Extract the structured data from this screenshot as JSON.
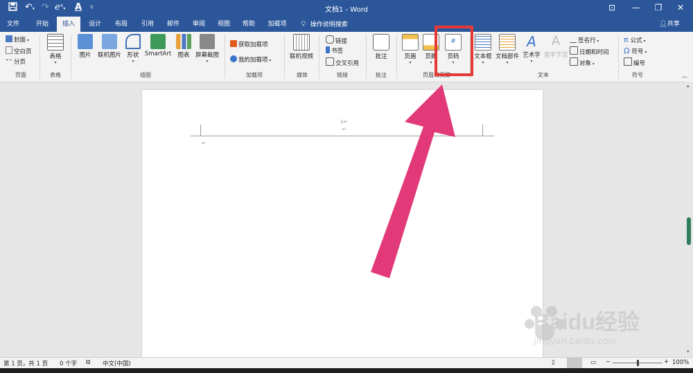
{
  "app": {
    "doc_title": "文档1 - Word"
  },
  "titlebar": {
    "share_label": "共享"
  },
  "tabs": [
    {
      "label": "文件"
    },
    {
      "label": "开始"
    },
    {
      "label": "插入"
    },
    {
      "label": "设计"
    },
    {
      "label": "布局"
    },
    {
      "label": "引用"
    },
    {
      "label": "邮件"
    },
    {
      "label": "审阅"
    },
    {
      "label": "视图"
    },
    {
      "label": "帮助"
    },
    {
      "label": "加载项"
    }
  ],
  "tellme": {
    "label": "操作说明搜索"
  },
  "ribbon": {
    "pages": {
      "cover": "封面",
      "blank": "空白页",
      "break": "分页",
      "group": "页面"
    },
    "tables": {
      "table": "表格",
      "group": "表格"
    },
    "illustrations": {
      "pictures": "图片",
      "online_pictures": "联机图片",
      "shapes": "形状",
      "smartart": "SmartArt",
      "chart": "图表",
      "screenshot": "屏幕截图",
      "group": "插图"
    },
    "addins": {
      "get": "获取加载项",
      "my": "我的加载项",
      "group": "加载项"
    },
    "media": {
      "online_video": "联机视频",
      "group": "媒体"
    },
    "links": {
      "link": "链接",
      "bookmark": "书签",
      "crossref": "交叉引用",
      "group": "链接"
    },
    "comments": {
      "comment": "批注",
      "group": "批注"
    },
    "header_footer": {
      "header": "页眉",
      "footer": "页脚",
      "page_number": "页码",
      "group": "页眉和页脚"
    },
    "text": {
      "textbox": "文本框",
      "quickparts": "文档部件",
      "wordart": "艺术字",
      "dropcap": "首字下沉",
      "signature": "签名行",
      "datetime": "日期和时间",
      "object": "对象",
      "group": "文本"
    },
    "symbols": {
      "equation": "公式",
      "symbol": "符号",
      "number": "编号",
      "group": "符号"
    }
  },
  "document": {
    "header_number": "1↵",
    "header_return": "↵",
    "body_return": "↵"
  },
  "status": {
    "page": "第 1 页，共 1 页",
    "words": "0 个字",
    "lang": "中文(中国)",
    "zoom": "100%"
  },
  "zoom_fraction": 0.5,
  "colors": {
    "brand": "#2b579a",
    "highlight": "#e53935",
    "arrow": "#e23a78"
  },
  "watermark": {
    "text": "Baidu经验",
    "url": "jingyan.baidu.com"
  }
}
